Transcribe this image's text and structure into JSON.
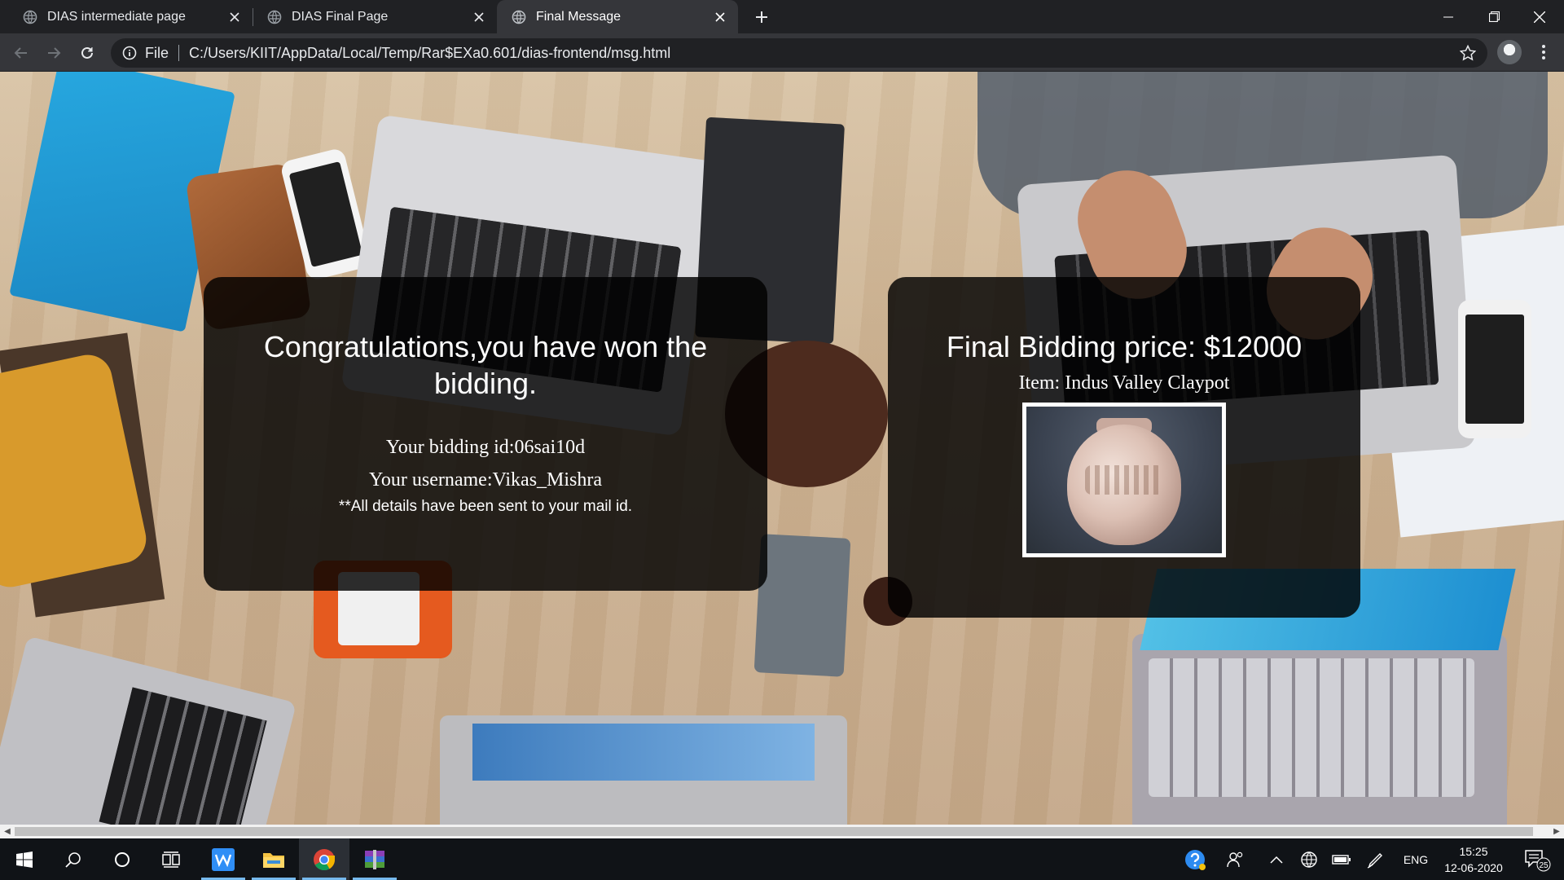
{
  "browser": {
    "tabs": [
      {
        "title": "DIAS intermediate page",
        "active": false
      },
      {
        "title": "DIAS Final Page",
        "active": false
      },
      {
        "title": "Final Message",
        "active": true
      }
    ],
    "address": {
      "scheme_label": "File",
      "url": "C:/Users/KIIT/AppData/Local/Temp/Rar$EXa0.601/dias-frontend/msg.html"
    }
  },
  "winner_card": {
    "headline": "Congratulations,you have won the bidding.",
    "bidding_id": "Your bidding id:06sai10d",
    "username": "Your username:Vikas_Mishra",
    "note": "**All details have been sent to your mail id."
  },
  "price_card": {
    "headline": "Final Bidding price: $12000",
    "item": "Item: Indus Valley Claypot"
  },
  "taskbar": {
    "apps": [
      "wps-office-icon",
      "file-explorer-icon",
      "chrome-icon",
      "winrar-icon"
    ],
    "tray": {
      "language": "ENG",
      "time": "15:25",
      "date": "12-06-2020",
      "notification_count": "25"
    }
  },
  "colors": {
    "tab_strip": "#202124",
    "toolbar": "#35363a",
    "card_background": "rgba(0,0,0,0.82)",
    "taskbar": "#101317"
  }
}
